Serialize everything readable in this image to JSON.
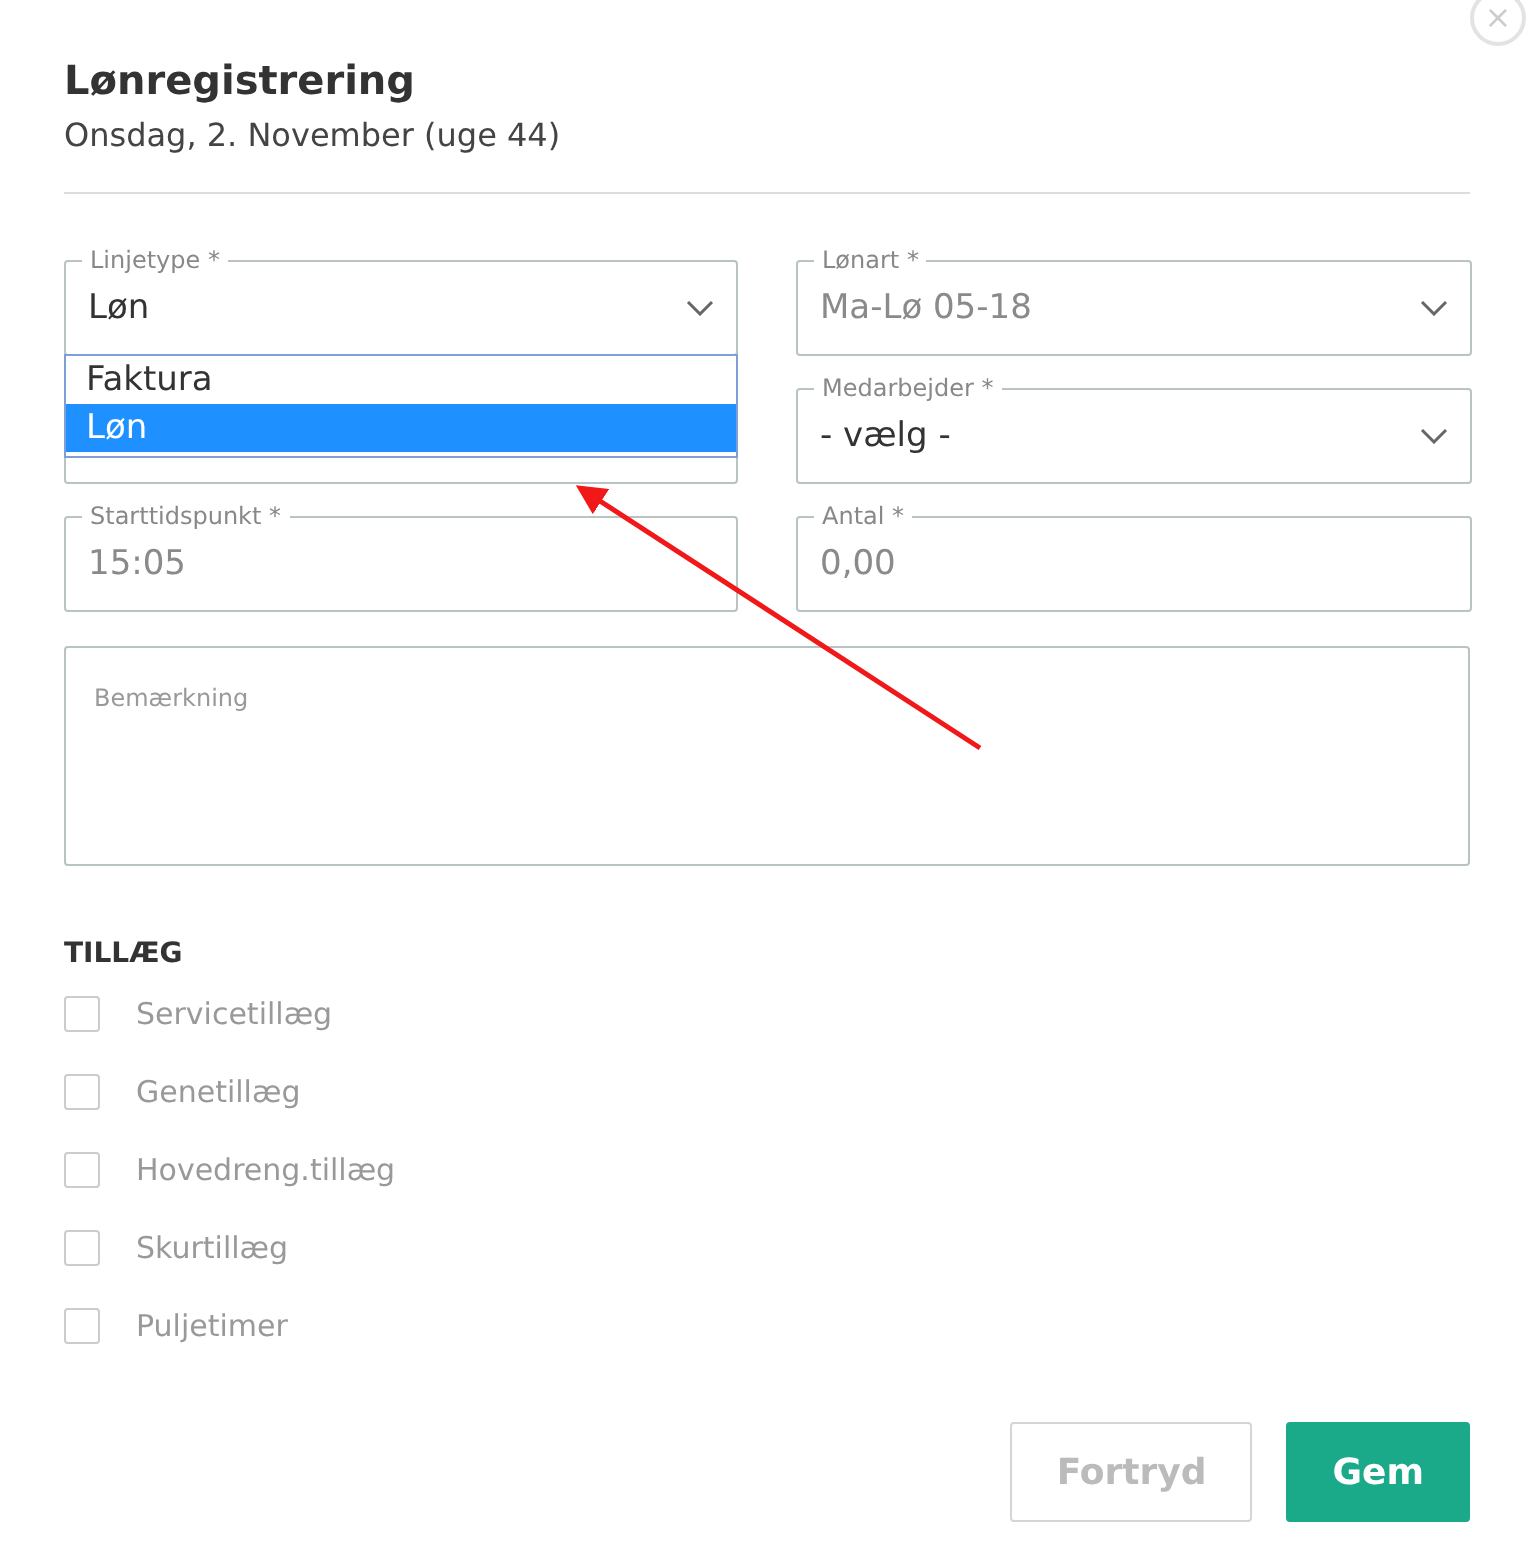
{
  "close": "×",
  "title": "Lønregistrering",
  "subtitle": "Onsdag, 2. November (uge 44)",
  "fields": [
    {
      "kind": "select",
      "label": "Linjetype *",
      "value": "Løn",
      "disabled": false,
      "dropdown": [
        {
          "label": "Faktura",
          "selected": false
        },
        {
          "label": "Løn",
          "selected": true
        }
      ]
    },
    {
      "kind": "select",
      "label": "Lønart *",
      "value": "Ma-Lø 05-18",
      "disabled": true
    },
    {
      "kind": "select"
    },
    {
      "kind": "select",
      "label": "Medarbejder *",
      "value": "- vælg -",
      "disabled": false
    },
    {
      "kind": "input",
      "label": "Starttidspunkt *",
      "value": "15:05",
      "disabled": true
    },
    {
      "kind": "input",
      "label": "Antal *",
      "value": "0,00",
      "disabled": true
    }
  ],
  "remark": {
    "placeholder": "Bemærkning"
  },
  "section_title": "TILLÆG",
  "allowances": [
    {
      "label": "Servicetillæg",
      "checked": false
    },
    {
      "label": "Genetillæg",
      "checked": false
    },
    {
      "label": "Hovedreng.tillæg",
      "checked": false
    },
    {
      "label": "Skurtillæg",
      "checked": false
    },
    {
      "label": "Puljetimer",
      "checked": false
    }
  ],
  "buttons": [
    {
      "kind": "secondary",
      "label": "Fortryd"
    },
    {
      "kind": "primary",
      "label": "Gem"
    }
  ]
}
